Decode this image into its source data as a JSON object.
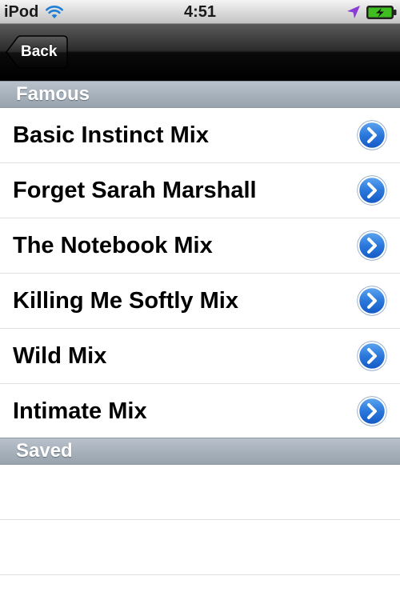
{
  "status_bar": {
    "carrier": "iPod",
    "time": "4:51",
    "battery_color": "#3fbf1f"
  },
  "nav_bar": {
    "back_label": "Back"
  },
  "sections": [
    {
      "title": "Famous",
      "items": [
        {
          "label": "Basic Instinct Mix"
        },
        {
          "label": "Forget Sarah Marshall"
        },
        {
          "label": "The Notebook Mix"
        },
        {
          "label": "Killing Me Softly Mix"
        },
        {
          "label": "Wild Mix"
        },
        {
          "label": "Intimate Mix"
        }
      ]
    },
    {
      "title": "Saved",
      "items": []
    }
  ],
  "colors": {
    "disclosure_blue": "#1f6fd8",
    "section_header": "#a6b0ba",
    "nav_bar": "#000000"
  },
  "icons": {
    "wifi": "wifi-icon",
    "location": "location-arrow-icon",
    "battery": "battery-charging-icon",
    "disclosure": "disclosure-chevron-icon"
  }
}
